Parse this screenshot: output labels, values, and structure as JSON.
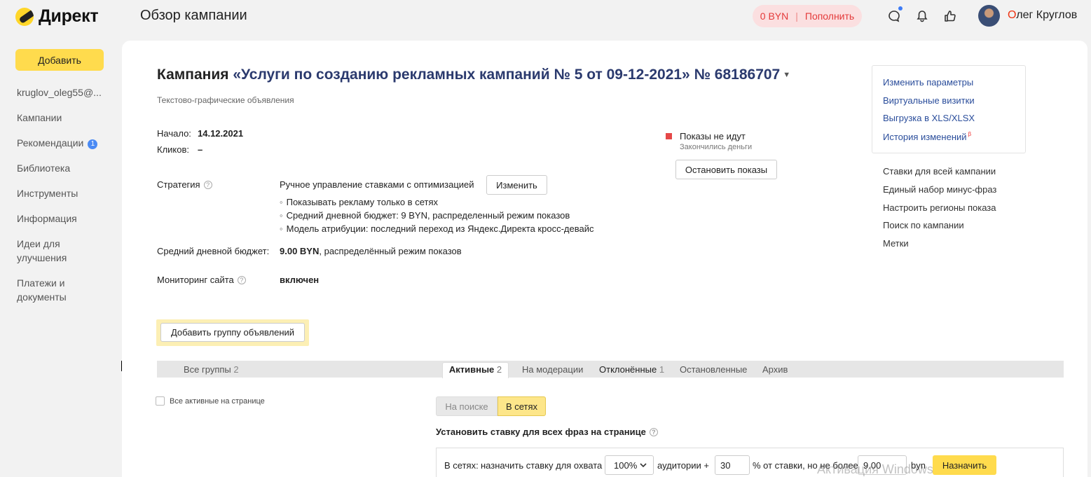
{
  "header": {
    "logo_text": "Директ",
    "page_title": "Обзор кампании",
    "balance_amount": "0 BYN",
    "balance_action": "Пополнить",
    "user_first_letter": "О",
    "user_name_rest": "лег Круглов"
  },
  "sidebar": {
    "add_button": "Добавить",
    "items": [
      {
        "label": "kruglov_oleg55@..."
      },
      {
        "label": "Кампании"
      },
      {
        "label": "Рекомендации",
        "badge": "1"
      },
      {
        "label": "Библиотека"
      },
      {
        "label": "Инструменты"
      },
      {
        "label": "Информация"
      },
      {
        "label": "Идеи для улучшения"
      },
      {
        "label": "Платежи и документы"
      }
    ]
  },
  "campaign": {
    "title_prefix": "Кампания",
    "title_name": "«Услуги по созданию рекламных кампаний № 5 от 09-12-2021» № 68186707",
    "type": "Текстово-графические объявления",
    "start_label": "Начало:",
    "start_value": "14.12.2021",
    "clicks_label": "Кликов:",
    "clicks_value": "–",
    "strategy_label": "Стратегия",
    "strategy_value": "Ручное управление ставками с оптимизацией",
    "strategy_change": "Изменить",
    "strategy_details": [
      "Показывать рекламу только в сетях",
      "Средний дневной бюджет: 9 BYN, распределенный режим показов",
      "Модель атрибуции: последний переход из Яндекс.Директа кросс-девайс"
    ],
    "budget_label": "Средний дневной бюджет:",
    "budget_value": "9.00 BYN",
    "budget_mode": ", распределённый режим показов",
    "monitoring_label": "Мониторинг сайта",
    "monitoring_value": "включен",
    "add_group_button": "Добавить группу объявлений"
  },
  "status": {
    "title": "Показы не идут",
    "subtitle": "Закончились деньги",
    "stop_button": "Остановить показы",
    "color": "#e54848"
  },
  "links_box": [
    "Изменить параметры",
    "Виртуальные визитки",
    "Выгрузка в XLS/XLSX",
    "История изменений"
  ],
  "links_beta": "β",
  "links_plain": [
    "Ставки для всей кампании",
    "Единый набор минус-фраз",
    "Настроить регионы показа",
    "Поиск по кампании",
    "Метки"
  ],
  "tabs": {
    "all_groups": "Все группы",
    "all_groups_count": "2",
    "active": "Активные",
    "active_count": "2",
    "moderation": "На модерации",
    "rejected": "Отклонённые",
    "rejected_count": "1",
    "stopped": "Остановленные",
    "archive": "Архив"
  },
  "bids": {
    "select_all_label": "Все активные на странице",
    "seg_search": "На поиске",
    "seg_networks": "В сетях",
    "title": "Установить ставку для всех фраз на странице",
    "prefix": "В сетях:",
    "assign_text": "назначить ставку для охвата",
    "coverage": "100%",
    "audience_text": "аудитории +",
    "percent_value": "30",
    "percent_text": "% от ставки, но не более",
    "max_value": "9.00",
    "currency": "byn",
    "assign_button": "Назначить"
  },
  "watermark": "Активация Windows",
  "colors": {
    "accent_yellow": "#ffdb4d",
    "link_blue": "#2a4d9b",
    "balance_red": "#e43a3a"
  }
}
